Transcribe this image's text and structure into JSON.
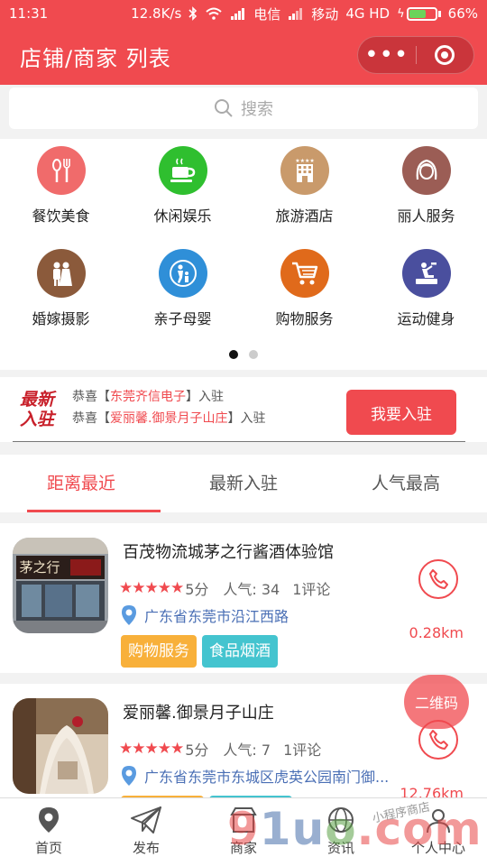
{
  "status_bar": {
    "time": "11:31",
    "net_speed": "12.8K/s",
    "carrier1": "电信",
    "carrier2": "移动",
    "network": "4G HD",
    "battery": "66%",
    "battery_level": 0.66
  },
  "header": {
    "title": "店铺/商家 列表"
  },
  "search": {
    "placeholder": "搜索"
  },
  "categories": [
    {
      "label": "餐饮美食",
      "icon": "cutlery-icon",
      "color": "#f06b6b"
    },
    {
      "label": "休闲娱乐",
      "icon": "coffee-cup-icon",
      "color": "#2fbf2f"
    },
    {
      "label": "旅游酒店",
      "icon": "hotel-icon",
      "color": "#c99a6b"
    },
    {
      "label": "丽人服务",
      "icon": "woman-face-icon",
      "color": "#9b5d55"
    },
    {
      "label": "婚嫁摄影",
      "icon": "couple-icon",
      "color": "#8b5a3b"
    },
    {
      "label": "亲子母婴",
      "icon": "parent-child-icon",
      "color": "#2f8fd8"
    },
    {
      "label": "购物服务",
      "icon": "shopping-cart-icon",
      "color": "#e06a1b"
    },
    {
      "label": "运动健身",
      "icon": "fitness-icon",
      "color": "#4a4f9e"
    }
  ],
  "pager": {
    "pages": 2,
    "current": 1
  },
  "join": {
    "logo_line1": "最新",
    "logo_line2": "入驻",
    "line1_prefix": "恭喜【",
    "line1_name": "东莞齐信电子",
    "line1_suffix": "】入驻",
    "line2_prefix": "恭喜【",
    "line2_name": "爱丽馨.御景月子山庄",
    "line2_suffix": "】入驻",
    "button": "我要入驻"
  },
  "tabs": [
    {
      "label": "距离最近",
      "active": true
    },
    {
      "label": "最新入驻",
      "active": false
    },
    {
      "label": "人气最高",
      "active": false
    }
  ],
  "shops": [
    {
      "name": "百茂物流城茅之行酱酒体验馆",
      "stars": "★★★★★",
      "score": "5分",
      "popularity": "人气: 34",
      "comments": "1评论",
      "address": "广东省东莞市沿江西路",
      "tags": [
        "购物服务",
        "食品烟酒"
      ],
      "distance": "0.28km",
      "photo_sign": "茅之行"
    },
    {
      "name": "爱丽馨.御景月子山庄",
      "stars": "★★★★★",
      "score": "5分",
      "popularity": "人气: 7",
      "comments": "1评论",
      "address": "广东省东莞市东城区虎英公园南门御...",
      "tags": [
        "",
        ""
      ],
      "distance": "12.76km"
    }
  ],
  "floating": {
    "qr_label": "二维码"
  },
  "bottom_nav": [
    {
      "label": "首页",
      "icon": "location-pin-icon"
    },
    {
      "label": "发布",
      "icon": "paper-plane-icon"
    },
    {
      "label": "商家",
      "icon": "shop-icon"
    },
    {
      "label": "资讯",
      "icon": "globe-icon"
    },
    {
      "label": "个人中心",
      "icon": "user-icon"
    }
  ],
  "watermark": {
    "text_a": "9",
    "text_b": "1u",
    "text_c": "o",
    "text_d": ".com",
    "sub": "小程序商店"
  },
  "colors": {
    "brand": "#f04a4f",
    "link": "#4a6fb5",
    "tag_orange": "#f8b03a",
    "tag_teal": "#44c4cf"
  }
}
